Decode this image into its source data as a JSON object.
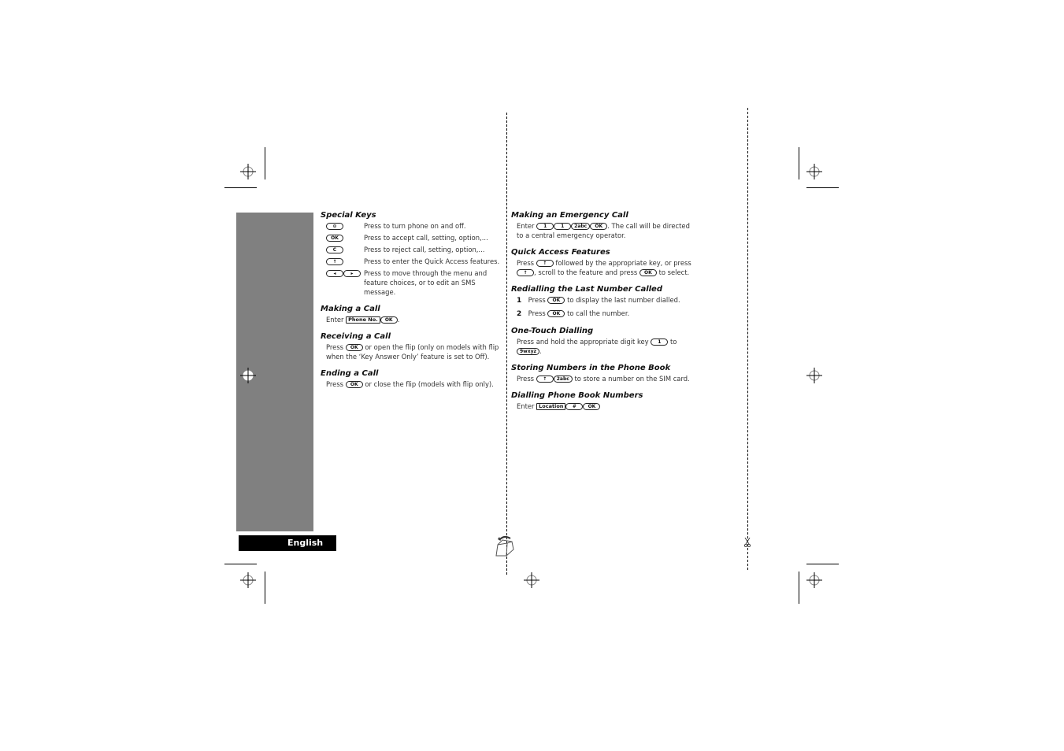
{
  "sidebar": {
    "language_tab": "English"
  },
  "left_column": {
    "special_keys": {
      "title": "Special Keys",
      "rows": [
        {
          "keys": [
            "⊙"
          ],
          "text": "Press to turn phone on and off."
        },
        {
          "keys": [
            "OK"
          ],
          "text": "Press to accept call, setting, option,..."
        },
        {
          "keys": [
            "C"
          ],
          "text": "Press to reject call, setting, option,..."
        },
        {
          "keys": [
            "↑"
          ],
          "text": "Press to enter the Quick Access features."
        },
        {
          "keys": [
            "◂",
            "▸"
          ],
          "text": "Press to move through the menu and feature choices, or to edit an SMS message."
        }
      ]
    },
    "making_call": {
      "title": "Making a Call",
      "prefix": "Enter",
      "key_box": "Phone No.",
      "key_ok": "OK",
      "suffix": "."
    },
    "receiving_call": {
      "title": "Receiving a Call",
      "prefix": "Press",
      "key": "OK",
      "text": "or open the flip (only on models with flip when the ‘Key Answer Only’  feature is set to Off)."
    },
    "ending_call": {
      "title": "Ending a Call",
      "prefix": "Press",
      "key": "OK",
      "text": "or close the flip (models with flip only)."
    }
  },
  "right_column": {
    "emergency_call": {
      "title": "Making an Emergency Call",
      "prefix": "Enter",
      "keys": [
        "1",
        "1",
        "2abc",
        "OK"
      ],
      "text": ". The call will be directed to a central emergency operator."
    },
    "quick_access": {
      "title": "Quick Access Features",
      "prefix": "Press",
      "key1": "↑",
      "text1": "followed by the appropriate key, or press",
      "key2": "↑",
      "text2": ", scroll to the feature and press",
      "key3": "OK",
      "text3": "to select."
    },
    "redialling": {
      "title": "Redialling the Last Number Called",
      "steps": [
        {
          "num": "1",
          "prefix": "Press",
          "key": "OK",
          "text": "to display the last number dialled."
        },
        {
          "num": "2",
          "prefix": "Press",
          "key": "OK",
          "text": "to call the number."
        }
      ]
    },
    "one_touch": {
      "title": "One-Touch Dialling",
      "text1": "Press and hold the appropriate digit key",
      "key1": "1",
      "text2": "to",
      "key2": "9wxyz",
      "suffix": "."
    },
    "storing": {
      "title": "Storing Numbers in the Phone Book",
      "prefix": "Press",
      "key1": "↑",
      "key2": "2abc",
      "text": "to store a number on the SIM card."
    },
    "dialling_book": {
      "title": "Dialling Phone Book Numbers",
      "prefix": "Enter",
      "key_box": "Location",
      "key2": "#",
      "key3": "OK"
    }
  },
  "icons": {
    "fold": "fold-page-icon",
    "scissors": "scissors-icon",
    "registration": "registration-mark-icon"
  }
}
